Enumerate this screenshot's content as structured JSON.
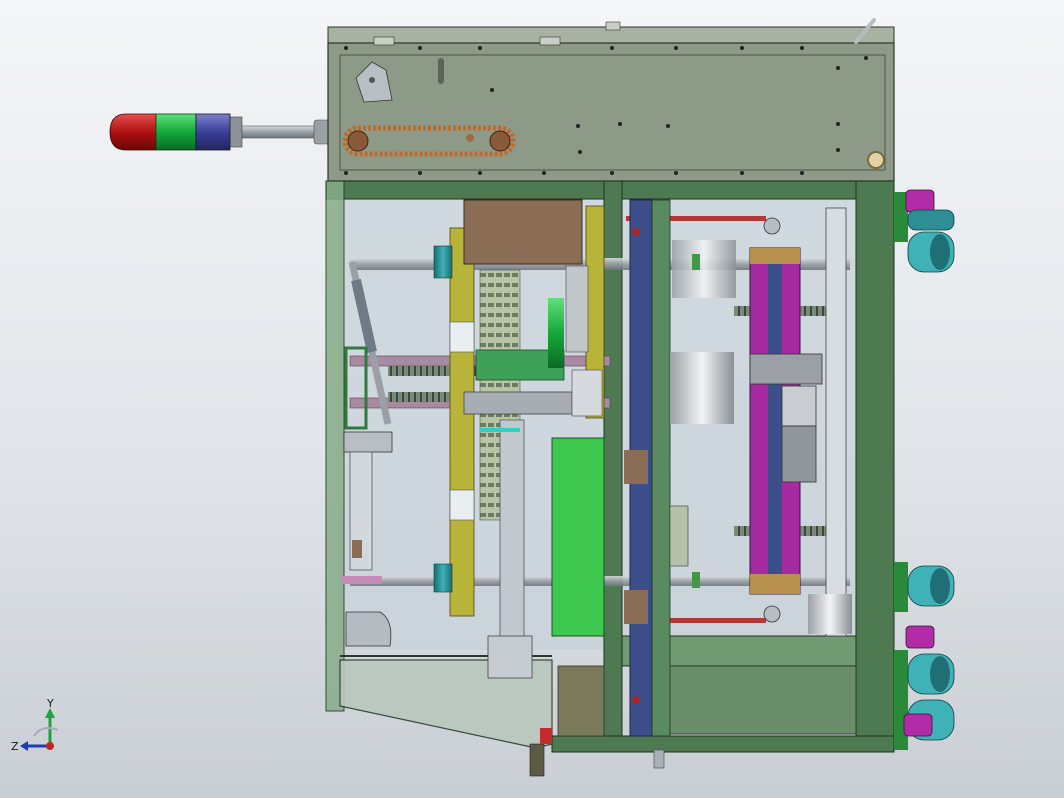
{
  "scene": {
    "background_top": "#f4f6f8",
    "background_bottom": "#c9ced4",
    "frame_color": "#4e7a52",
    "panel_color": "#8e9a88",
    "chain_color": "#c0692a"
  },
  "signal_tower": {
    "colors": [
      "#c01818",
      "#19b043",
      "#3a3f9a"
    ]
  },
  "triad": {
    "axis_y": "Y",
    "axis_z": "Z"
  }
}
